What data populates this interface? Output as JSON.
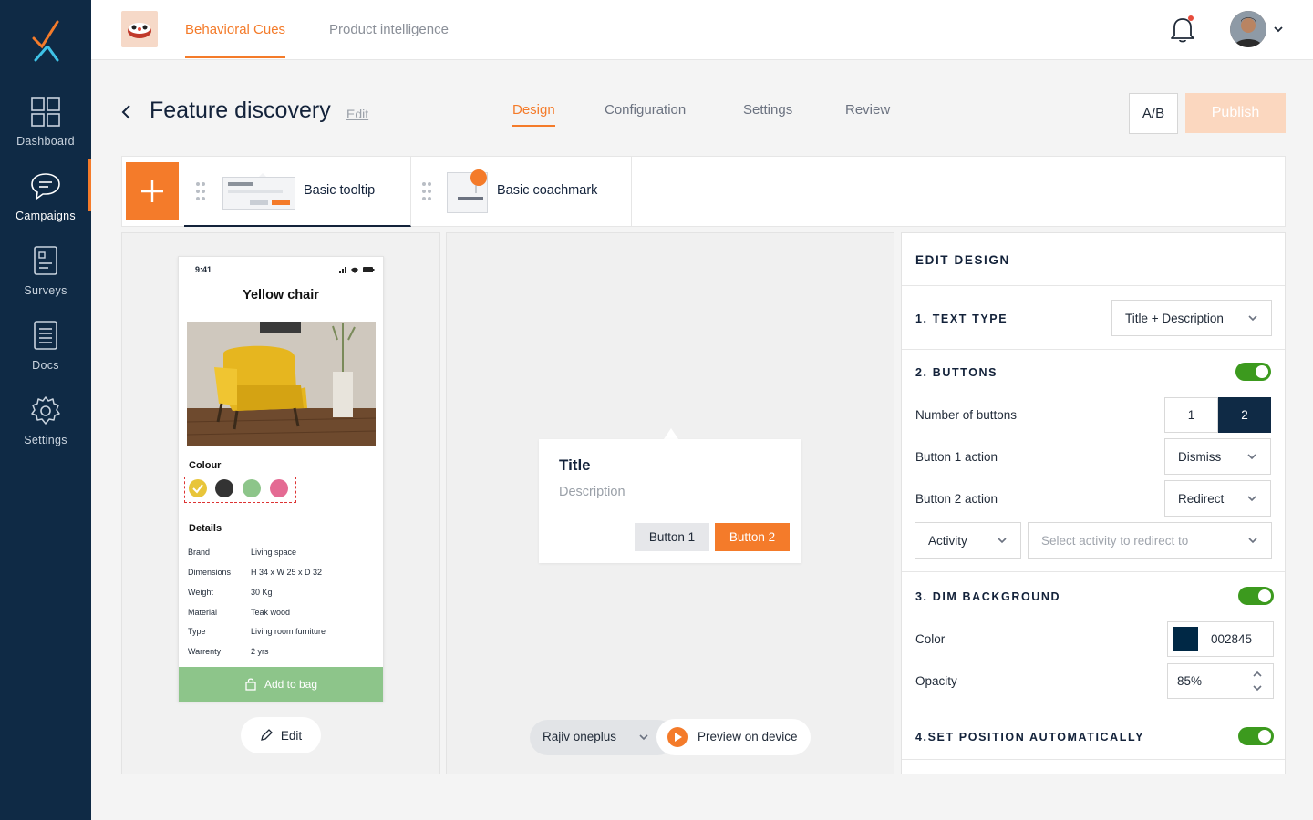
{
  "sidebar": {
    "items": [
      {
        "label": "Dashboard",
        "icon": "dashboard-icon"
      },
      {
        "label": "Campaigns",
        "icon": "chat-bubble-icon",
        "active": true
      },
      {
        "label": "Surveys",
        "icon": "survey-icon"
      },
      {
        "label": "Docs",
        "icon": "docs-icon"
      },
      {
        "label": "Settings",
        "icon": "gear-icon"
      }
    ]
  },
  "header": {
    "tabs": [
      {
        "label": "Behavioral Cues",
        "active": true
      },
      {
        "label": "Product intelligence",
        "active": false
      }
    ]
  },
  "page": {
    "title": "Feature discovery",
    "edit_label": "Edit",
    "steps": [
      "Design",
      "Configuration",
      "Settings",
      "Review"
    ],
    "active_step": "Design",
    "ab_label": "A/B",
    "publish_label": "Publish"
  },
  "templates": [
    {
      "label": "Basic tooltip",
      "active": true
    },
    {
      "label": "Basic coachmark",
      "active": false
    }
  ],
  "phone": {
    "time": "9:41",
    "product_title": "Yellow chair",
    "colour_label": "Colour",
    "colours": [
      "#e8c53a",
      "#333333",
      "#8dc58a",
      "#e46a93"
    ],
    "details_label": "Details",
    "details": [
      {
        "key": "Brand",
        "value": "Living space"
      },
      {
        "key": "Dimensions",
        "value": "H 34 x W 25 x D 32"
      },
      {
        "key": "Weight",
        "value": "30 Kg"
      },
      {
        "key": "Material",
        "value": "Teak wood"
      },
      {
        "key": "Type",
        "value": "Living room furniture"
      },
      {
        "key": "Warrenty",
        "value": "2 yrs"
      }
    ],
    "add_to_bag": "Add to bag",
    "edit_label": "Edit"
  },
  "tooltip": {
    "title": "Title",
    "description": "Description",
    "button1": "Button 1",
    "button2": "Button 2"
  },
  "preview": {
    "device": "Rajiv oneplus",
    "button": "Preview on device"
  },
  "edit_design": {
    "heading": "EDIT DESIGN",
    "text_type": {
      "heading": "1. TEXT TYPE",
      "value": "Title + Description"
    },
    "buttons": {
      "heading": "2. BUTTONS",
      "enabled": true,
      "number_label": "Number of buttons",
      "options": [
        "1",
        "2"
      ],
      "selected": "2",
      "button1_action_label": "Button 1 action",
      "button1_action": "Dismiss",
      "button2_action_label": "Button 2 action",
      "button2_action": "Redirect",
      "redirect_type": "Activity",
      "redirect_placeholder": "Select activity to redirect to"
    },
    "dim_background": {
      "heading": "3. DIM BACKGROUND",
      "enabled": true,
      "color_label": "Color",
      "color_value": "002845",
      "color_hex": "#002845",
      "opacity_label": "Opacity",
      "opacity_value": "85%"
    },
    "set_position": {
      "heading": "4.SET POSITION AUTOMATICALLY",
      "enabled": true
    }
  },
  "colors": {
    "accent": "#f47b2a",
    "sidebar": "#0f2a45",
    "toggle_on": "#3c9a1e"
  }
}
